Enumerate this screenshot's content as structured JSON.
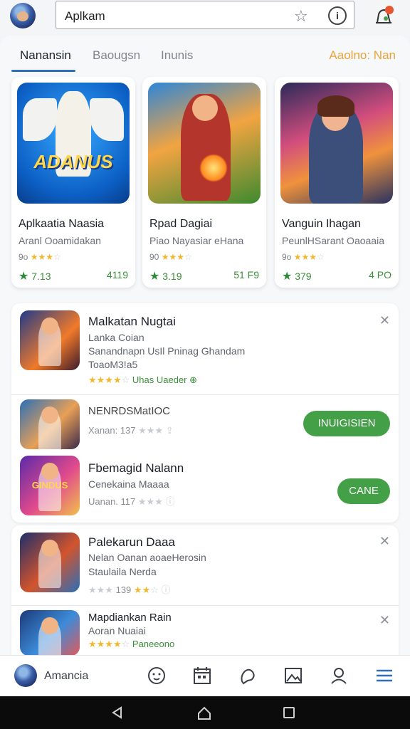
{
  "header": {
    "search_text": "Aplkam",
    "star_icon": "star-outline-icon",
    "info_icon": "info-icon",
    "notif_icon": "bell-notification-icon"
  },
  "tabs": {
    "items": [
      {
        "label": "Nanansin",
        "active": true
      },
      {
        "label": "Baougsn",
        "active": false
      },
      {
        "label": "Inunis",
        "active": false
      }
    ],
    "right_label": "Aaolno: Nan"
  },
  "featured": [
    {
      "title": "Aplkaatia Naasia",
      "subtitle": "Aranl Ooamidakan",
      "rating_prefix": "9o",
      "score": "7.13",
      "size": "4119",
      "art_text": "ADANUS"
    },
    {
      "title": "Rpad Dagiai",
      "subtitle": "Piao Nayasiar eHana",
      "rating_prefix": "90",
      "score": "3.19",
      "size": "51 F9"
    },
    {
      "title": "Vanguin Ihagan",
      "subtitle": "PeunlHSarant Oaoaaia",
      "rating_prefix": "9o",
      "score": "379",
      "size": "4 PO"
    }
  ],
  "list1": {
    "rows": [
      {
        "title": "Malkatan Nugtai",
        "line1": "Lanka Coian",
        "line2": "Sanandnapn UsIl Pninag Ghandam",
        "line3": "ToaoM3!a5",
        "meta_tail": "Uhas Uaeder"
      },
      {
        "title": "NENRDSMatIOC",
        "meta": "Xanan: 137",
        "button": "INUIGISIEN"
      },
      {
        "title": "Fbemagid Nalann",
        "line1": "Cenekaina Maaaa",
        "meta": "Uanan. 117",
        "button": "CANE",
        "art_text": "GINDUS"
      }
    ]
  },
  "list2": {
    "rows": [
      {
        "title": "Palekarun Daaa",
        "line1": "Nelan Oanan aoaeHerosin",
        "line2": "Staulaila Nerda",
        "meta": "139"
      },
      {
        "title": "Mapdiankan Rain",
        "line1": "Aoran Nuaiai",
        "meta_tail": "Paneeono"
      }
    ]
  },
  "bottom_nav": {
    "label": "Amancia",
    "icons": [
      "face-icon",
      "calendar-icon",
      "chat-icon",
      "image-icon",
      "profile-icon",
      "menu-icon"
    ]
  },
  "colors": {
    "accent": "#2f6fb3",
    "install": "#43a047",
    "star": "#f1b730",
    "rating_green": "#2e8b3a",
    "tab_orange": "#e8a33a"
  }
}
